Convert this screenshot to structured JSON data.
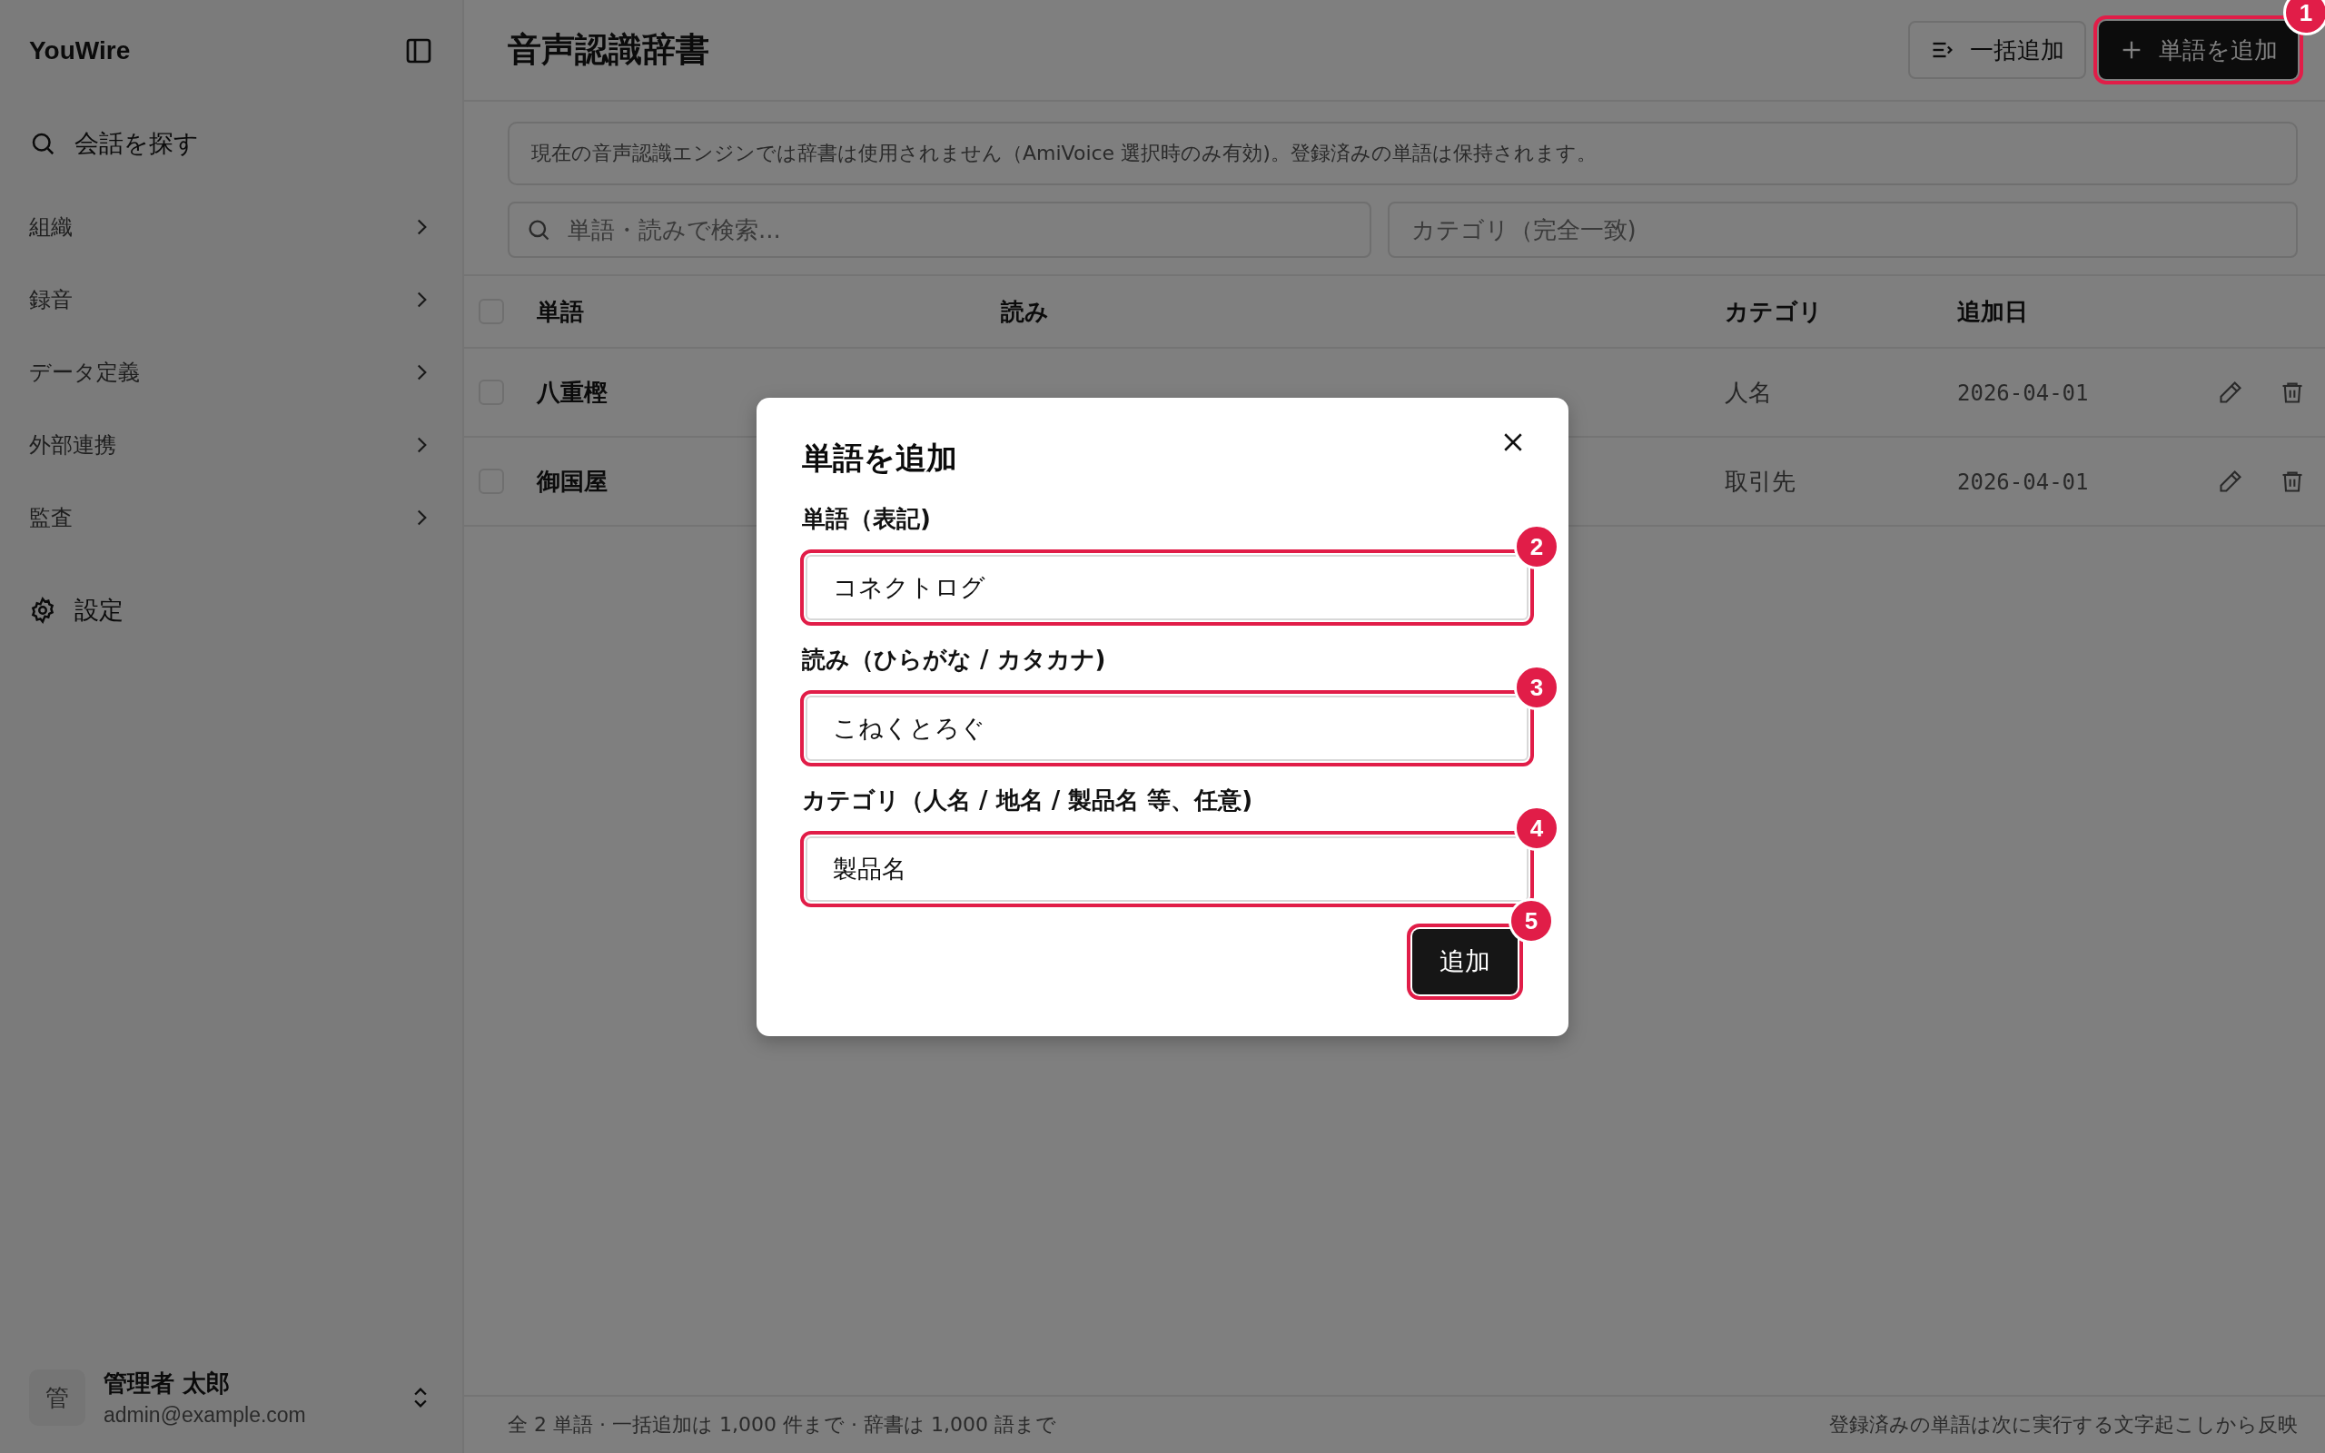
{
  "app": {
    "name": "YouWire"
  },
  "sidebar": {
    "search_label": "会話を探す",
    "items": [
      {
        "label": "組織",
        "expandable": true
      },
      {
        "label": "録音",
        "expandable": true
      },
      {
        "label": "データ定義",
        "expandable": true
      },
      {
        "label": "外部連携",
        "expandable": true
      },
      {
        "label": "監査",
        "expandable": true
      }
    ],
    "settings_label": "設定",
    "user": {
      "avatar": "管",
      "name": "管理者 太郎",
      "email": "admin@example.com"
    }
  },
  "header": {
    "title": "音声認識辞書",
    "bulk_button": "一括追加",
    "add_button": {
      "label": "単語を追加",
      "marker": "1"
    }
  },
  "notice": "現在の音声認識エンジンでは辞書は使用されません（AmiVoice 選択時のみ有効)。登録済みの単語は保持されます。",
  "search": {
    "placeholder": "単語・読みで検索..."
  },
  "category_filter": {
    "placeholder": "カテゴリ（完全一致)"
  },
  "table": {
    "columns": [
      "単語",
      "読み",
      "カテゴリ",
      "追加日"
    ],
    "header_checked": false,
    "rows": [
      {
        "checked": false,
        "word": "八重樫",
        "category": "人名",
        "date": "2026-04-01"
      },
      {
        "checked": false,
        "word": "御国屋",
        "category": "取引先",
        "date": "2026-04-01"
      }
    ]
  },
  "status_bar": {
    "left": "全 2 単語 · 一括追加は 1,000 件まで · 辞書は 1,000 語まで",
    "right": "登録済みの単語は次に実行する文字起こしから反映"
  },
  "dialog": {
    "title": "単語を追加",
    "fields": [
      {
        "label": "単語（表記)",
        "value": "コネクトログ",
        "marker": "2"
      },
      {
        "label": "読み（ひらがな / カタカナ)",
        "value": "こねくとろぐ",
        "marker": "3"
      },
      {
        "label": "カテゴリ（人名 / 地名 / 製品名 等、任意)",
        "value": "製品名",
        "marker": "4"
      }
    ],
    "submit": {
      "label": "追加",
      "marker": "5"
    }
  }
}
